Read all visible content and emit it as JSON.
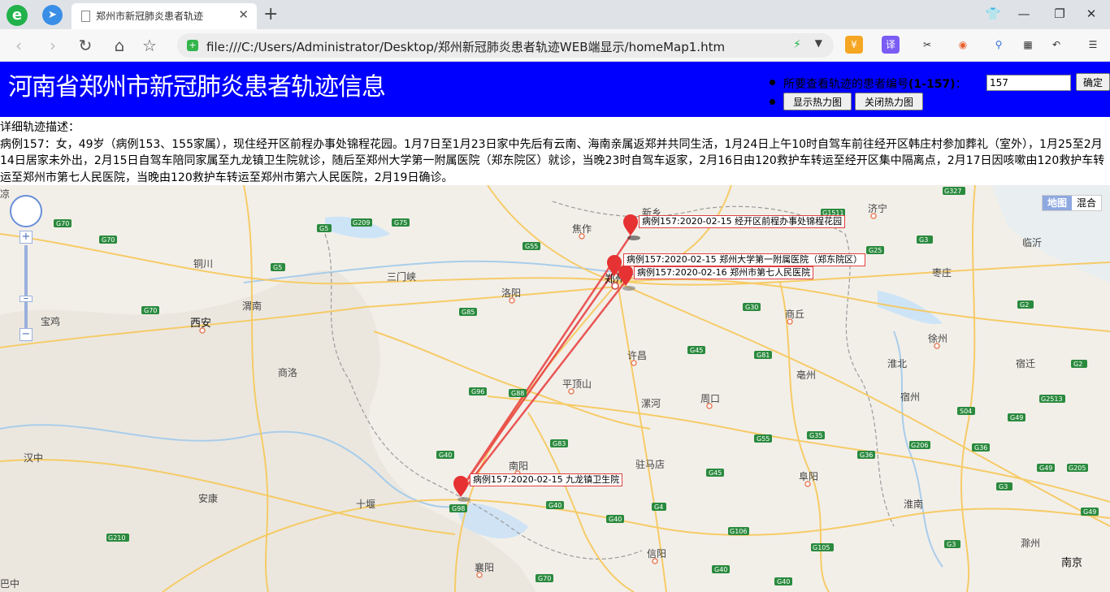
{
  "browser": {
    "logo": "e",
    "tab_title": "郑州市新冠肺炎患者轨迹",
    "url": "file:///C:/Users/Administrator/Desktop/郑州新冠肺炎患者轨迹WEB端显示/homeMap1.htm",
    "ext_labels": [
      "¥",
      "译"
    ]
  },
  "header": {
    "title": "河南省郑州市新冠肺炎患者轨迹信息",
    "patient_label_prefix": "所要查看轨迹的患者编号",
    "patient_label_range": "(1-157)",
    "patient_label_suffix": "：",
    "patient_input_value": "157",
    "confirm_button": "确定",
    "show_heatmap_button": "显示热力图",
    "close_heatmap_button": "关闭热力图"
  },
  "description": {
    "heading": "详细轨迹描述：",
    "text": "病例157：女，49岁（病例153、155家属），现住经开区前程办事处锦程花园。1月7日至1月23日家中先后有云南、海南亲属返郑并共同生活，1月24日上午10时自驾车前往经开区韩庄村参加葬礼（室外），1月25至2月14日居家未外出，2月15日自驾车陪同家属至九龙镇卫生院就诊，随后至郑州大学第一附属医院（郑东院区）就诊，当晚23时自驾车返家，2月16日由120救护车转运至经开区集中隔离点，2月17日因咳嗽由120救护车转运至郑州市第七人民医院，当晚由120救护车转运至郑州市第六人民医院，2月19日确诊。"
  },
  "map": {
    "type_map": "地图",
    "type_hybrid": "混合",
    "markers": [
      "病例157:2020-02-15 经开区前程办事处锦程花园",
      "病例157:2020-02-15 郑州大学第一附属医院（郑东院区）",
      "病例157:2020-02-16 郑州市第七人民医院",
      "病例157:2020-02-15 九龙镇卫生院"
    ],
    "cities": [
      "焦作",
      "新乡",
      "济宁",
      "临沂",
      "铜川",
      "三门峡",
      "洛阳",
      "郑州",
      "枣庄",
      "宝鸡",
      "西安",
      "渭南",
      "商丘",
      "徐州",
      "许昌",
      "淮北",
      "宿迁",
      "商洛",
      "平顶山",
      "亳州",
      "漯河",
      "周口",
      "宿州",
      "汉中",
      "南阳",
      "驻马店",
      "安康",
      "十堰",
      "阜阳",
      "淮南",
      "信阳",
      "滁州",
      "襄阳",
      "南京",
      "凉",
      "巴中"
    ],
    "shields": [
      "G70",
      "G70",
      "G209",
      "G75",
      "G5",
      "G55",
      "G1511",
      "G3",
      "G327",
      "G5",
      "G70",
      "G85",
      "G30",
      "G45",
      "G81",
      "G96",
      "G88",
      "G83",
      "G55",
      "G40",
      "G35",
      "G36",
      "G206",
      "G40",
      "G45",
      "G40",
      "G4",
      "G98",
      "G106",
      "G210",
      "G2",
      "G2513",
      "G49",
      "G49",
      "G205",
      "G49",
      "G3",
      "G105",
      "G40",
      "G70",
      "G40",
      "G25",
      "G2",
      "G3",
      "S04",
      "G36"
    ]
  }
}
